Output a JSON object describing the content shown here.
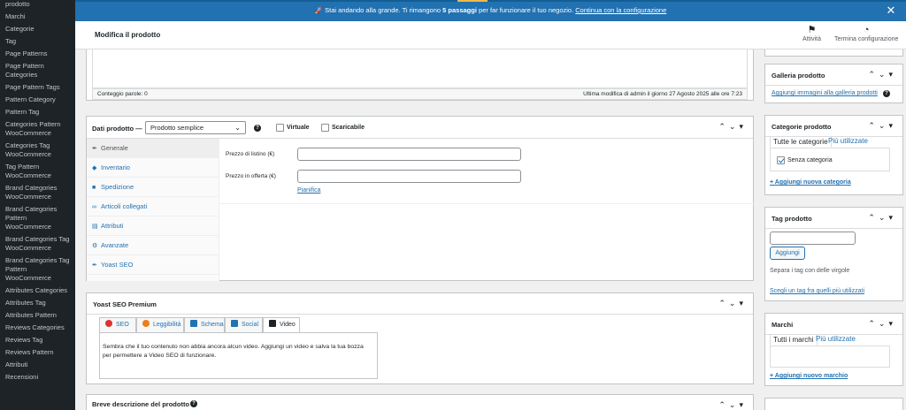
{
  "sidebar": {
    "items": [
      [
        "prodotto"
      ],
      [
        "Marchi"
      ],
      [
        "Categorie"
      ],
      [
        "Tag"
      ],
      [
        "Page Patterns"
      ],
      [
        "Page Pattern",
        "Categories"
      ],
      [
        "Page Pattern Tags"
      ],
      [
        "Pattern Category"
      ],
      [
        "Pattern Tag"
      ],
      [
        "Categories Pattern",
        "WooCommerce"
      ],
      [
        "Categories Tag",
        "WooCommerce"
      ],
      [
        "Tag Pattern",
        "WooCommerce"
      ],
      [
        "Brand Categories",
        "WooCommerce"
      ],
      [
        "Brand Categories",
        "Pattern",
        "WooCommerce"
      ],
      [
        "Brand Categories Tag",
        "WooCommerce"
      ],
      [
        "Brand Categories Tag",
        "Pattern",
        "WooCommerce"
      ],
      [
        "Attributes Categories"
      ],
      [
        "Attributes Tag"
      ],
      [
        "Attributes Pattern"
      ],
      [
        "Reviews Categories"
      ],
      [
        "Reviews Tag"
      ],
      [
        "Reviews Pattern"
      ],
      [
        "Attributi"
      ],
      [
        "Recensioni"
      ]
    ]
  },
  "banner": {
    "prefix": "🚀 Stai andando alla grande. Ti rimangono ",
    "bold": "5 passaggi",
    "suffix": " per far funzionare il tuo negozio. ",
    "link": "Continua con la configurazione",
    "close_icon": "✕"
  },
  "header": {
    "title": "Modifica il prodotto",
    "activity_label": "Attività",
    "setup_label": "Termina configurazione",
    "activity_icon": "⚑",
    "setup_icon": "◔"
  },
  "editor": {
    "word_count": "Conteggio parole: 0",
    "last_modified": "Ultima modifica di admin il giorno 27 Agosto 2025 alle ore 7:23"
  },
  "product_data": {
    "title": "Dati prodotto —",
    "type_select": "Prodotto semplice",
    "virtual_label": "Virtuale",
    "downloadable_label": "Scaricabile",
    "tabs": [
      {
        "icon": "✒",
        "label": "Generale"
      },
      {
        "icon": "◆",
        "label": "Inventario"
      },
      {
        "icon": "■",
        "label": "Spedizione"
      },
      {
        "icon": "∞",
        "label": "Articoli collegati"
      },
      {
        "icon": "▤",
        "label": "Attributi"
      },
      {
        "icon": "⚙",
        "label": "Avanzate"
      },
      {
        "icon": "✒",
        "label": "Yoast SEO"
      }
    ],
    "regular_price_label": "Prezzo di listino (€)",
    "sale_price_label": "Prezzo in offerta (€)",
    "schedule_link": "Pianifica"
  },
  "yoast": {
    "title": "Yoast SEO Premium",
    "tabs": [
      {
        "label": "SEO",
        "color": "#dc3232"
      },
      {
        "label": "Leggibilità",
        "color": "#ee7c1b"
      },
      {
        "label": "Schema",
        "color": "#2271b1"
      },
      {
        "label": "Social",
        "color": "#2271b1"
      },
      {
        "label": "Video",
        "color": "#1d2327"
      }
    ],
    "video_text_1": "Sembra che il tuo contenuto non abbia ancora alcun video. Aggiungi un video e salva la tua bozza",
    "video_text_2": "per permettere a Video SEO di funzionare."
  },
  "short_description": {
    "title": "Breve descrizione del prodotto"
  },
  "gallery": {
    "title": "Galleria prodotto",
    "link": "Aggiungi immagini alla galleria prodotti"
  },
  "categories": {
    "title": "Categorie prodotto",
    "tab_all": "Tutte le categorie",
    "tab_popular": "Più utilizzate",
    "item": "Senza categoria",
    "add_link": "+ Aggiungi nuova categoria"
  },
  "tags": {
    "title": "Tag prodotto",
    "add_button": "Aggiungi",
    "hint": "Separa i tag con delle virgole",
    "popular_link": "Scegli un tag fra quelli più utilizzati"
  },
  "brands": {
    "title": "Marchi",
    "tab_all": "Tutti i marchi",
    "tab_popular": "Più utilizzate",
    "add_link": "+ Aggiungi nuovo marchio"
  },
  "icons": {
    "chevron_up": "⌃",
    "chevron_down": "⌄",
    "triangle": "▾",
    "help": "?"
  },
  "colors": {
    "sidebar_bg": "#1d2327",
    "banner_bg": "#2271b1",
    "link": "#2271b1"
  }
}
